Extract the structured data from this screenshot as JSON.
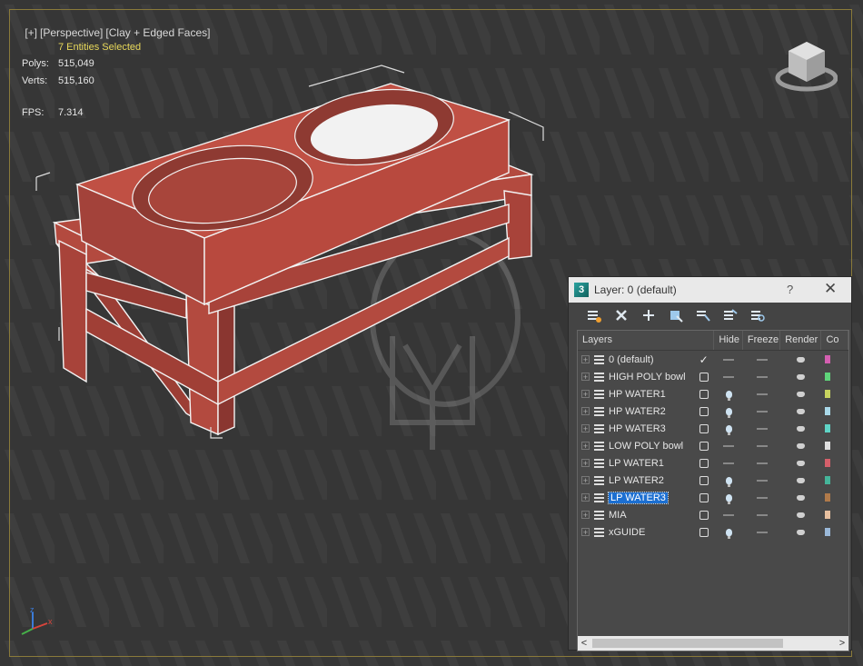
{
  "viewport": {
    "labels": [
      "[+]",
      "[Perspective]",
      "[Clay + Edged Faces]"
    ],
    "stats": {
      "selection": "7 Entities Selected",
      "polys_label": "Polys:",
      "polys_value": "515,049",
      "verts_label": "Verts:",
      "verts_value": "515,160",
      "fps_label": "FPS:",
      "fps_value": "7.314"
    },
    "axis": {
      "z": "z",
      "x": "x"
    },
    "icons": {
      "viewcube": "viewcube-icon",
      "axis": "axis-gizmo-icon"
    },
    "colors": {
      "model": "#b6463c",
      "stats_text": "#e8d85a",
      "background": "#3a3a3a"
    }
  },
  "layer_dialog": {
    "title": "Layer: 0 (default)",
    "app_icon_letter": "3",
    "help_label": "?",
    "close_label": "✕",
    "toolbar": [
      "layer-settings-icon",
      "delete-layer-icon",
      "add-layer-icon",
      "select-objects-icon",
      "select-layer-icon",
      "highlight-layer-icon",
      "sync-layer-icon"
    ],
    "columns": [
      "Layers",
      "Hide",
      "Freeze",
      "Render",
      "Co"
    ],
    "layers": [
      {
        "name": "0 (default)",
        "current": "check",
        "hide": "dash",
        "freeze": "dash",
        "render": "teapot",
        "color": "#d45fb0"
      },
      {
        "name": "HIGH POLY bowl",
        "current": "box",
        "hide": "dash",
        "freeze": "dash",
        "render": "teapot",
        "color": "#5fd47a"
      },
      {
        "name": "HP WATER1",
        "current": "box",
        "hide": "bulb",
        "freeze": "dash",
        "render": "teapot",
        "color": "#c8d45f"
      },
      {
        "name": "HP WATER2",
        "current": "box",
        "hide": "bulb",
        "freeze": "dash",
        "render": "teapot",
        "color": "#a9d8e8"
      },
      {
        "name": "HP WATER3",
        "current": "box",
        "hide": "bulb",
        "freeze": "dash",
        "render": "teapot",
        "color": "#5fd4c6"
      },
      {
        "name": "LOW POLY bowl",
        "current": "box",
        "hide": "dash",
        "freeze": "dash",
        "render": "teapot",
        "color": "#e0e0e0"
      },
      {
        "name": "LP WATER1",
        "current": "box",
        "hide": "dash",
        "freeze": "dash",
        "render": "teapot",
        "color": "#d45f6a"
      },
      {
        "name": "LP WATER2",
        "current": "box",
        "hide": "bulb",
        "freeze": "dash",
        "render": "teapot",
        "color": "#45b59a"
      },
      {
        "name": "LP WATER3",
        "current": "box",
        "hide": "bulb",
        "freeze": "dash",
        "render": "teapot",
        "color": "#b07a4a",
        "selected": true
      },
      {
        "name": "MIA",
        "current": "box",
        "hide": "dash",
        "freeze": "dash",
        "render": "teapot",
        "color": "#e8c0a0"
      },
      {
        "name": "xGUIDE",
        "current": "box",
        "hide": "bulb",
        "freeze": "dash",
        "render": "teapot",
        "color": "#9ab8d8"
      }
    ],
    "scroll_left": "<",
    "scroll_right": ">"
  }
}
